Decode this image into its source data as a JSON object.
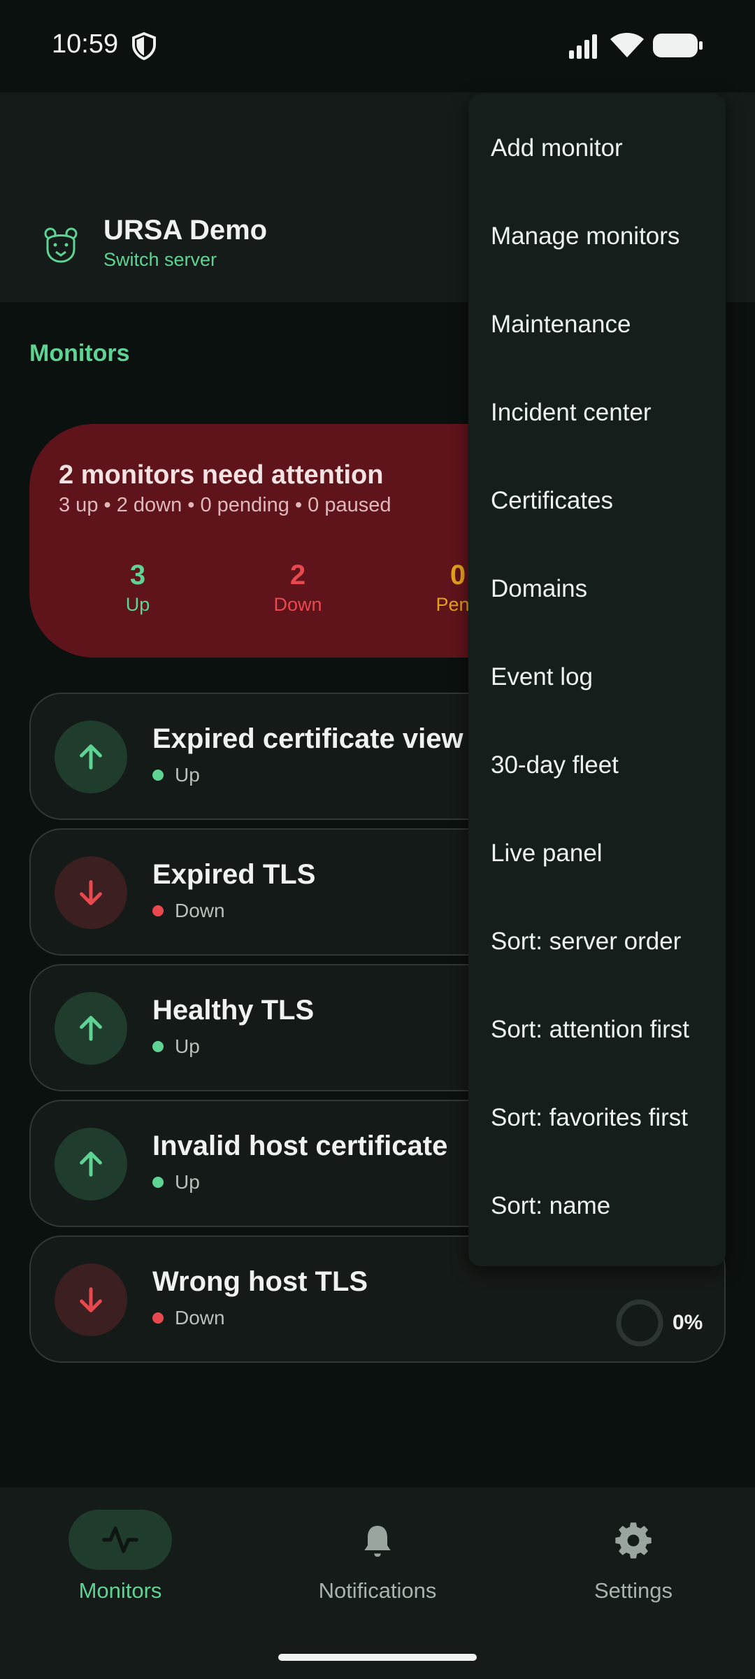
{
  "status_bar": {
    "time": "10:59"
  },
  "header": {
    "server_name": "URSA Demo",
    "switch_label": "Switch server"
  },
  "section_title": "Monitors",
  "summary": {
    "title": "2 monitors need attention",
    "subtitle": "3 up • 2 down • 0 pending • 0 paused",
    "stats": [
      {
        "value": "3",
        "label": "Up"
      },
      {
        "value": "2",
        "label": "Down"
      },
      {
        "value": "0",
        "label": "Pend"
      }
    ]
  },
  "monitors": [
    {
      "name": "Expired certificate view",
      "status": "Up"
    },
    {
      "name": "Expired TLS",
      "status": "Down"
    },
    {
      "name": "Healthy TLS",
      "status": "Up"
    },
    {
      "name": "Invalid host certificate",
      "status": "Up"
    },
    {
      "name": "Wrong host TLS",
      "status": "Down",
      "uptime": "0%"
    }
  ],
  "menu": {
    "items": [
      "Add monitor",
      "Manage monitors",
      "Maintenance",
      "Incident center",
      "Certificates",
      "Domains",
      "Event log",
      "30-day fleet",
      "Live panel",
      "Sort: server order",
      "Sort: attention first",
      "Sort: favorites first",
      "Sort: name"
    ]
  },
  "bottom_nav": {
    "items": [
      {
        "label": "Monitors",
        "icon": "pulse-icon",
        "active": true
      },
      {
        "label": "Notifications",
        "icon": "bell-icon",
        "active": false
      },
      {
        "label": "Settings",
        "icon": "gear-icon",
        "active": false
      }
    ]
  },
  "colors": {
    "accent": "#5fd393",
    "danger": "#e8494f",
    "warning": "#e3a01d",
    "card_alert": "#5e141a"
  }
}
